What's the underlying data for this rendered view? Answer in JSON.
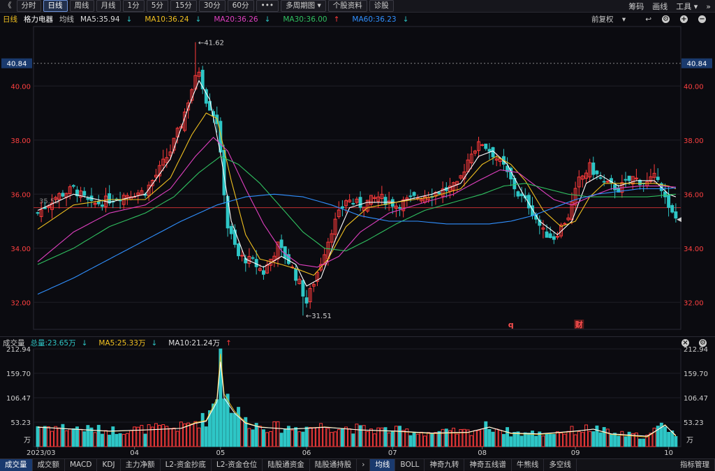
{
  "toolbar": {
    "back": "《",
    "periods": [
      "分时",
      "日线",
      "周线",
      "月线",
      "1分",
      "5分",
      "15分",
      "30分",
      "60分"
    ],
    "active": "日线",
    "more": "•••",
    "multi_period": "多周期图",
    "profile": "个股资料",
    "diagnose": "诊股",
    "right_items": [
      "筹码",
      "画线",
      "工具"
    ],
    "expand": "»"
  },
  "infobar": {
    "period": "日线",
    "stock_name": "格力电器",
    "ma_label": "均线",
    "ma5": "MA5:35.94",
    "ma10": "MA10:36.24",
    "ma20": "MA20:36.26",
    "ma30": "MA30:36.00",
    "ma60": "MA60:36.23",
    "adjust": "前复权"
  },
  "volbar": {
    "title": "成交量",
    "total": "总量:23.65万",
    "ma5": "MA5:25.33万",
    "ma10": "MA10:21.24万"
  },
  "bottom_tabs": [
    "成交量",
    "成交额",
    "MACD",
    "KDJ",
    "主力净额",
    "L2-资金抄底",
    "L2-资金仓位",
    "陆股通资金",
    "陆股通持股",
    "均线",
    "BOLL",
    "神奇九转",
    "神奇五线谱",
    "牛熊线",
    "多空线",
    "指标管理"
  ],
  "bottom_active": [
    "成交量",
    "均线"
  ],
  "bottom_arrow": "›",
  "colors": {
    "up": "#ff3b3b",
    "down": "#2ec6c6",
    "ma5": "#ffffff",
    "ma10": "#f0c020",
    "ma20": "#e040c0",
    "ma30": "#30c060",
    "ma60": "#3090ff"
  },
  "chart_data": {
    "type": "candlestick",
    "price_axis": {
      "min": 31.0,
      "max": 42.2,
      "ticks": [
        "40.00",
        "38.00",
        "36.00",
        "34.00",
        "32.00"
      ],
      "tick_values": [
        40,
        38,
        36,
        34,
        32
      ],
      "crosshair": "40.84",
      "crosshair_value": 40.84,
      "ref_line": 35.5
    },
    "volume_axis": {
      "max": 212.94,
      "ticks": [
        "212.94",
        "159.70",
        "106.47",
        "53.23"
      ],
      "tick_values": [
        212.94,
        159.7,
        106.47,
        53.23
      ],
      "unit": "万"
    },
    "x_labels": [
      "2023/03",
      "04",
      "05",
      "06",
      "07",
      "08",
      "09",
      "10"
    ],
    "x_label_index": [
      0,
      27,
      51,
      75,
      99,
      124,
      150,
      176
    ],
    "annotations": {
      "high": "41.62",
      "high_value": 41.62,
      "high_index": 44,
      "low": "31.51",
      "low_value": 31.51,
      "low_index": 74,
      "start_label": "35.50"
    },
    "event_markers": [
      "q",
      "财"
    ],
    "event_index": [
      132,
      151
    ],
    "close_keypoints": [
      [
        0,
        35.3
      ],
      [
        5,
        35.9
      ],
      [
        10,
        36.2
      ],
      [
        15,
        35.6
      ],
      [
        20,
        35.8
      ],
      [
        25,
        36.0
      ],
      [
        30,
        36.1
      ],
      [
        33,
        36.7
      ],
      [
        37,
        37.6
      ],
      [
        40,
        38.6
      ],
      [
        43,
        39.9
      ],
      [
        45,
        40.6
      ],
      [
        47,
        39.5
      ],
      [
        50,
        38.7
      ],
      [
        53,
        34.8
      ],
      [
        56,
        33.7
      ],
      [
        60,
        33.5
      ],
      [
        63,
        33.1
      ],
      [
        67,
        34.1
      ],
      [
        70,
        33.5
      ],
      [
        73,
        32.7
      ],
      [
        75,
        32.0
      ],
      [
        79,
        33.5
      ],
      [
        82,
        34.7
      ],
      [
        86,
        35.8
      ],
      [
        90,
        35.6
      ],
      [
        95,
        35.9
      ],
      [
        100,
        35.6
      ],
      [
        106,
        35.9
      ],
      [
        112,
        36.1
      ],
      [
        117,
        36.3
      ],
      [
        121,
        37.6
      ],
      [
        124,
        37.9
      ],
      [
        127,
        37.5
      ],
      [
        130,
        37.0
      ],
      [
        134,
        36.0
      ],
      [
        137,
        35.6
      ],
      [
        141,
        34.6
      ],
      [
        144,
        34.4
      ],
      [
        148,
        35.2
      ],
      [
        151,
        36.5
      ],
      [
        154,
        37.0
      ],
      [
        158,
        36.4
      ],
      [
        162,
        36.2
      ],
      [
        166,
        36.6
      ],
      [
        170,
        36.4
      ],
      [
        173,
        36.7
      ],
      [
        176,
        35.4
      ],
      [
        178,
        35.1
      ]
    ],
    "volume_keypoints": [
      [
        0,
        45
      ],
      [
        10,
        40
      ],
      [
        20,
        35
      ],
      [
        30,
        38
      ],
      [
        40,
        42
      ],
      [
        44,
        55
      ],
      [
        47,
        60
      ],
      [
        50,
        110
      ],
      [
        51,
        212.9
      ],
      [
        52,
        120
      ],
      [
        55,
        80
      ],
      [
        58,
        55
      ],
      [
        62,
        45
      ],
      [
        70,
        40
      ],
      [
        75,
        42
      ],
      [
        80,
        45
      ],
      [
        90,
        38
      ],
      [
        100,
        35
      ],
      [
        110,
        30
      ],
      [
        120,
        32
      ],
      [
        126,
        45
      ],
      [
        132,
        30
      ],
      [
        140,
        28
      ],
      [
        150,
        35
      ],
      [
        155,
        40
      ],
      [
        160,
        28
      ],
      [
        170,
        22
      ],
      [
        175,
        50
      ],
      [
        178,
        24
      ]
    ],
    "ma_series": [
      {
        "name": "MA5",
        "key": "ma5",
        "keypoints": [
          [
            0,
            35.4
          ],
          [
            10,
            36.0
          ],
          [
            20,
            35.7
          ],
          [
            30,
            36.0
          ],
          [
            37,
            37.3
          ],
          [
            42,
            39.2
          ],
          [
            45,
            40.2
          ],
          [
            48,
            39.5
          ],
          [
            51,
            37.5
          ],
          [
            54,
            35.0
          ],
          [
            58,
            33.6
          ],
          [
            63,
            33.3
          ],
          [
            68,
            33.7
          ],
          [
            72,
            33.4
          ],
          [
            75,
            32.6
          ],
          [
            79,
            32.9
          ],
          [
            83,
            34.3
          ],
          [
            87,
            35.5
          ],
          [
            92,
            35.7
          ],
          [
            100,
            35.7
          ],
          [
            110,
            36.0
          ],
          [
            118,
            36.4
          ],
          [
            123,
            37.4
          ],
          [
            127,
            37.6
          ],
          [
            131,
            37.1
          ],
          [
            135,
            36.1
          ],
          [
            140,
            35.0
          ],
          [
            145,
            34.5
          ],
          [
            149,
            35.0
          ],
          [
            153,
            36.4
          ],
          [
            157,
            36.7
          ],
          [
            162,
            36.3
          ],
          [
            167,
            36.5
          ],
          [
            172,
            36.5
          ],
          [
            176,
            36.0
          ],
          [
            178,
            35.9
          ]
        ]
      },
      {
        "name": "MA10",
        "key": "ma10",
        "keypoints": [
          [
            0,
            34.7
          ],
          [
            10,
            35.6
          ],
          [
            20,
            35.8
          ],
          [
            30,
            35.8
          ],
          [
            37,
            36.6
          ],
          [
            43,
            38.2
          ],
          [
            47,
            39.0
          ],
          [
            50,
            38.8
          ],
          [
            54,
            36.5
          ],
          [
            58,
            34.5
          ],
          [
            62,
            33.6
          ],
          [
            68,
            33.4
          ],
          [
            73,
            33.2
          ],
          [
            77,
            33.0
          ],
          [
            81,
            33.6
          ],
          [
            86,
            34.8
          ],
          [
            92,
            35.5
          ],
          [
            100,
            35.7
          ],
          [
            110,
            35.9
          ],
          [
            118,
            36.2
          ],
          [
            124,
            37.1
          ],
          [
            128,
            37.4
          ],
          [
            132,
            37.1
          ],
          [
            136,
            36.5
          ],
          [
            141,
            35.4
          ],
          [
            146,
            34.8
          ],
          [
            150,
            35.0
          ],
          [
            154,
            35.9
          ],
          [
            158,
            36.4
          ],
          [
            165,
            36.4
          ],
          [
            172,
            36.4
          ],
          [
            176,
            36.3
          ],
          [
            178,
            36.2
          ]
        ]
      },
      {
        "name": "MA20",
        "key": "ma20",
        "keypoints": [
          [
            0,
            33.5
          ],
          [
            10,
            34.6
          ],
          [
            20,
            35.3
          ],
          [
            30,
            35.6
          ],
          [
            37,
            36.2
          ],
          [
            44,
            37.4
          ],
          [
            49,
            38.1
          ],
          [
            53,
            37.6
          ],
          [
            58,
            36.2
          ],
          [
            63,
            34.9
          ],
          [
            68,
            33.9
          ],
          [
            73,
            33.4
          ],
          [
            78,
            33.3
          ],
          [
            84,
            33.7
          ],
          [
            90,
            34.6
          ],
          [
            98,
            35.3
          ],
          [
            108,
            35.7
          ],
          [
            116,
            36.0
          ],
          [
            123,
            36.5
          ],
          [
            129,
            36.9
          ],
          [
            134,
            36.8
          ],
          [
            139,
            36.3
          ],
          [
            144,
            35.8
          ],
          [
            149,
            35.6
          ],
          [
            154,
            35.9
          ],
          [
            160,
            36.2
          ],
          [
            168,
            36.3
          ],
          [
            174,
            36.3
          ],
          [
            178,
            36.26
          ]
        ]
      },
      {
        "name": "MA30",
        "key": "ma30",
        "keypoints": [
          [
            0,
            33.4
          ],
          [
            10,
            34.0
          ],
          [
            20,
            34.8
          ],
          [
            30,
            35.3
          ],
          [
            38,
            35.9
          ],
          [
            45,
            36.8
          ],
          [
            51,
            37.4
          ],
          [
            56,
            37.1
          ],
          [
            62,
            36.4
          ],
          [
            68,
            35.5
          ],
          [
            74,
            34.6
          ],
          [
            80,
            34.0
          ],
          [
            86,
            33.9
          ],
          [
            92,
            34.3
          ],
          [
            100,
            34.9
          ],
          [
            108,
            35.4
          ],
          [
            116,
            35.7
          ],
          [
            124,
            36.0
          ],
          [
            130,
            36.3
          ],
          [
            136,
            36.4
          ],
          [
            142,
            36.2
          ],
          [
            148,
            36.0
          ],
          [
            154,
            35.9
          ],
          [
            162,
            35.9
          ],
          [
            170,
            35.9
          ],
          [
            178,
            36.0
          ]
        ]
      },
      {
        "name": "MA60",
        "key": "ma60",
        "keypoints": [
          [
            0,
            32.3
          ],
          [
            10,
            32.9
          ],
          [
            20,
            33.6
          ],
          [
            30,
            34.3
          ],
          [
            40,
            35.0
          ],
          [
            50,
            35.6
          ],
          [
            58,
            35.9
          ],
          [
            66,
            36.0
          ],
          [
            74,
            35.9
          ],
          [
            82,
            35.6
          ],
          [
            90,
            35.2
          ],
          [
            98,
            35.0
          ],
          [
            106,
            35.0
          ],
          [
            114,
            34.9
          ],
          [
            120,
            34.9
          ],
          [
            126,
            34.9
          ],
          [
            132,
            35.0
          ],
          [
            138,
            35.2
          ],
          [
            144,
            35.5
          ],
          [
            150,
            35.8
          ],
          [
            156,
            36.0
          ],
          [
            162,
            36.1
          ],
          [
            168,
            36.2
          ],
          [
            174,
            36.2
          ],
          [
            178,
            36.23
          ]
        ]
      }
    ]
  }
}
